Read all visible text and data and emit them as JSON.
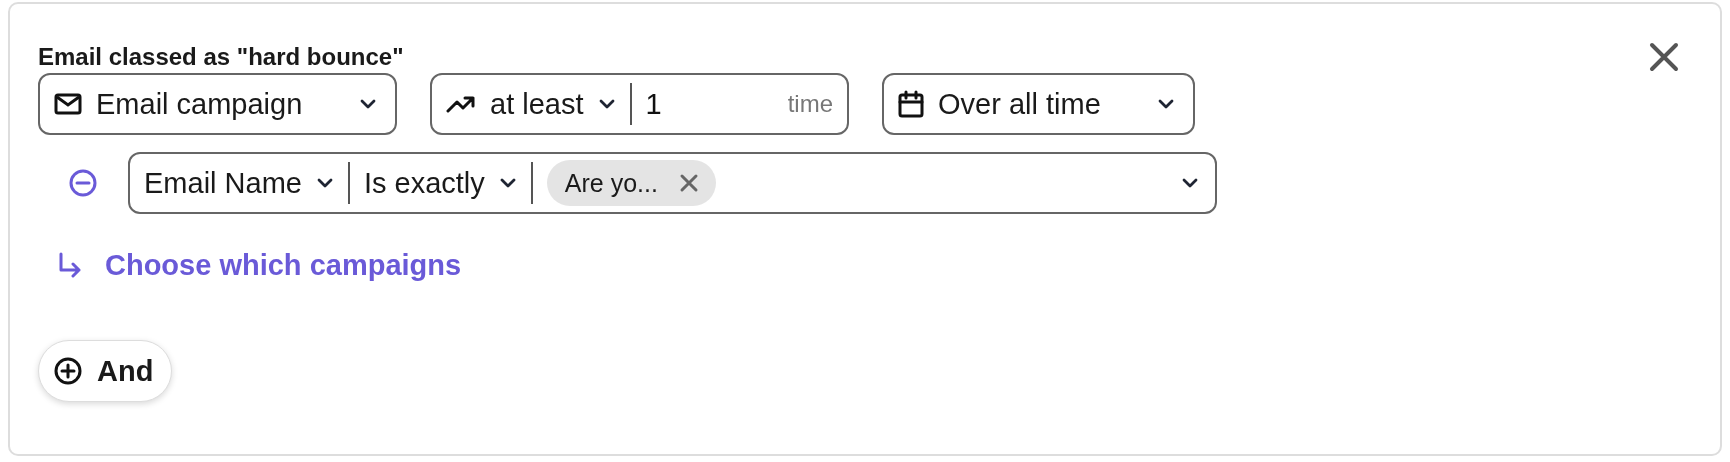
{
  "title": "Email classed as \"hard bounce\"",
  "source": {
    "label": "Email campaign"
  },
  "frequency": {
    "operator": "at least",
    "value": "1",
    "unit": "time"
  },
  "period": {
    "label": "Over all time"
  },
  "filter": {
    "field": "Email Name",
    "operator": "Is exactly",
    "tags": [
      {
        "label": "Are yo..."
      }
    ]
  },
  "link": {
    "label": "Choose which campaigns"
  },
  "add_button": {
    "label": "And"
  }
}
